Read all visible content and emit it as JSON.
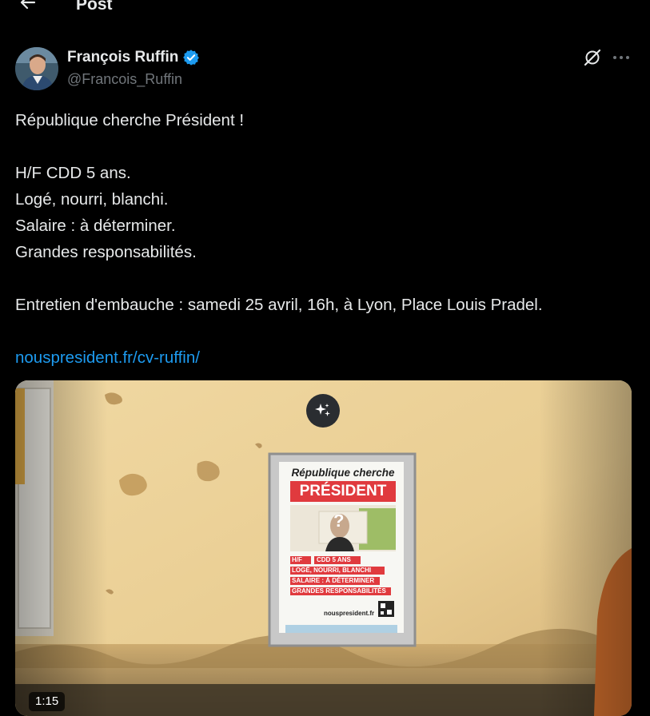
{
  "header": {
    "title": "Post",
    "back_icon": "arrow-left-icon"
  },
  "author": {
    "name": "François Ruffin",
    "handle": "@Francois_Ruffin",
    "verified_icon": "verified-badge-icon",
    "verified_color": "#1d9bf0"
  },
  "actions": {
    "grok_icon": "grok-icon",
    "more_icon": "more-horizontal-icon"
  },
  "tweet": {
    "line1": "République cherche Président !",
    "line2": "H/F CDD 5 ans.",
    "line3": "Logé, nourri, blanchi.",
    "line4": "Salaire : à déterminer.",
    "line5": "Grandes responsabilités.",
    "line6": "Entretien d'embauche : samedi 25 avril, 16h, à Lyon, Place Louis Pradel.",
    "link": "nouspresident.fr/cv-ruffin/"
  },
  "media": {
    "ai_icon": "sparkles-icon",
    "duration": "1:15",
    "poster": {
      "title_top": "République cherche",
      "title_main": "PRÉSIDENT",
      "line_hf": "H/F",
      "line_cdd": "CDD 5 ANS",
      "line_loge": "LOGÉ, NOURRI, BLANCHI",
      "line_salaire": "SALAIRE : À DÉTERMINER",
      "line_grandes": "GRANDES RESPONSABILITÉS",
      "site": "nouspresident.fr",
      "question_mark": "?"
    }
  },
  "colors": {
    "link": "#1d9bf0",
    "text": "#e7e9ea",
    "muted": "#71767b",
    "poster_red": "#e03a3e"
  }
}
